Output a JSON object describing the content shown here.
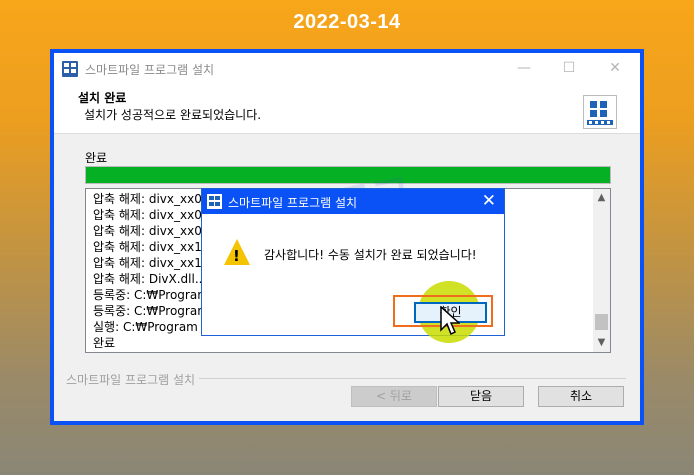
{
  "date_banner": "2022-03-14",
  "installer": {
    "title": "스마트파일 프로그램 설치",
    "controls": {
      "minimize": "—",
      "maximize": "☐",
      "close": "✕"
    },
    "header": {
      "title": "설치 완료",
      "subtitle": "설치가 성공적으로 완료되었습니다."
    },
    "status_label": "완료",
    "progress_percent": 100,
    "log_lines": [
      "압축 해제: divx_xx0",
      "압축 해제: divx_xx0",
      "압축 해제: divx_xx0",
      "압축 해제: divx_xx1",
      "압축 해제: divx_xx1",
      "압축 해제: DivX.dll...",
      "등록중: C:₩Program",
      "등록중: C:₩Program",
      "실행: C:₩Program",
      "완료"
    ],
    "group_label": "스마트파일 프로그램 설치",
    "buttons": {
      "back": "< 뒤로",
      "close": "닫음",
      "cancel": "취소"
    }
  },
  "dialog": {
    "title": "스마트파일 프로그램 설치",
    "message": "감사합니다! 수동 설치가 완료 되었습니다!",
    "ok_label": "확인"
  },
  "colors": {
    "accent_frame": "#0a52f5",
    "progress": "#06b025",
    "highlight_box": "#f06d1e"
  }
}
